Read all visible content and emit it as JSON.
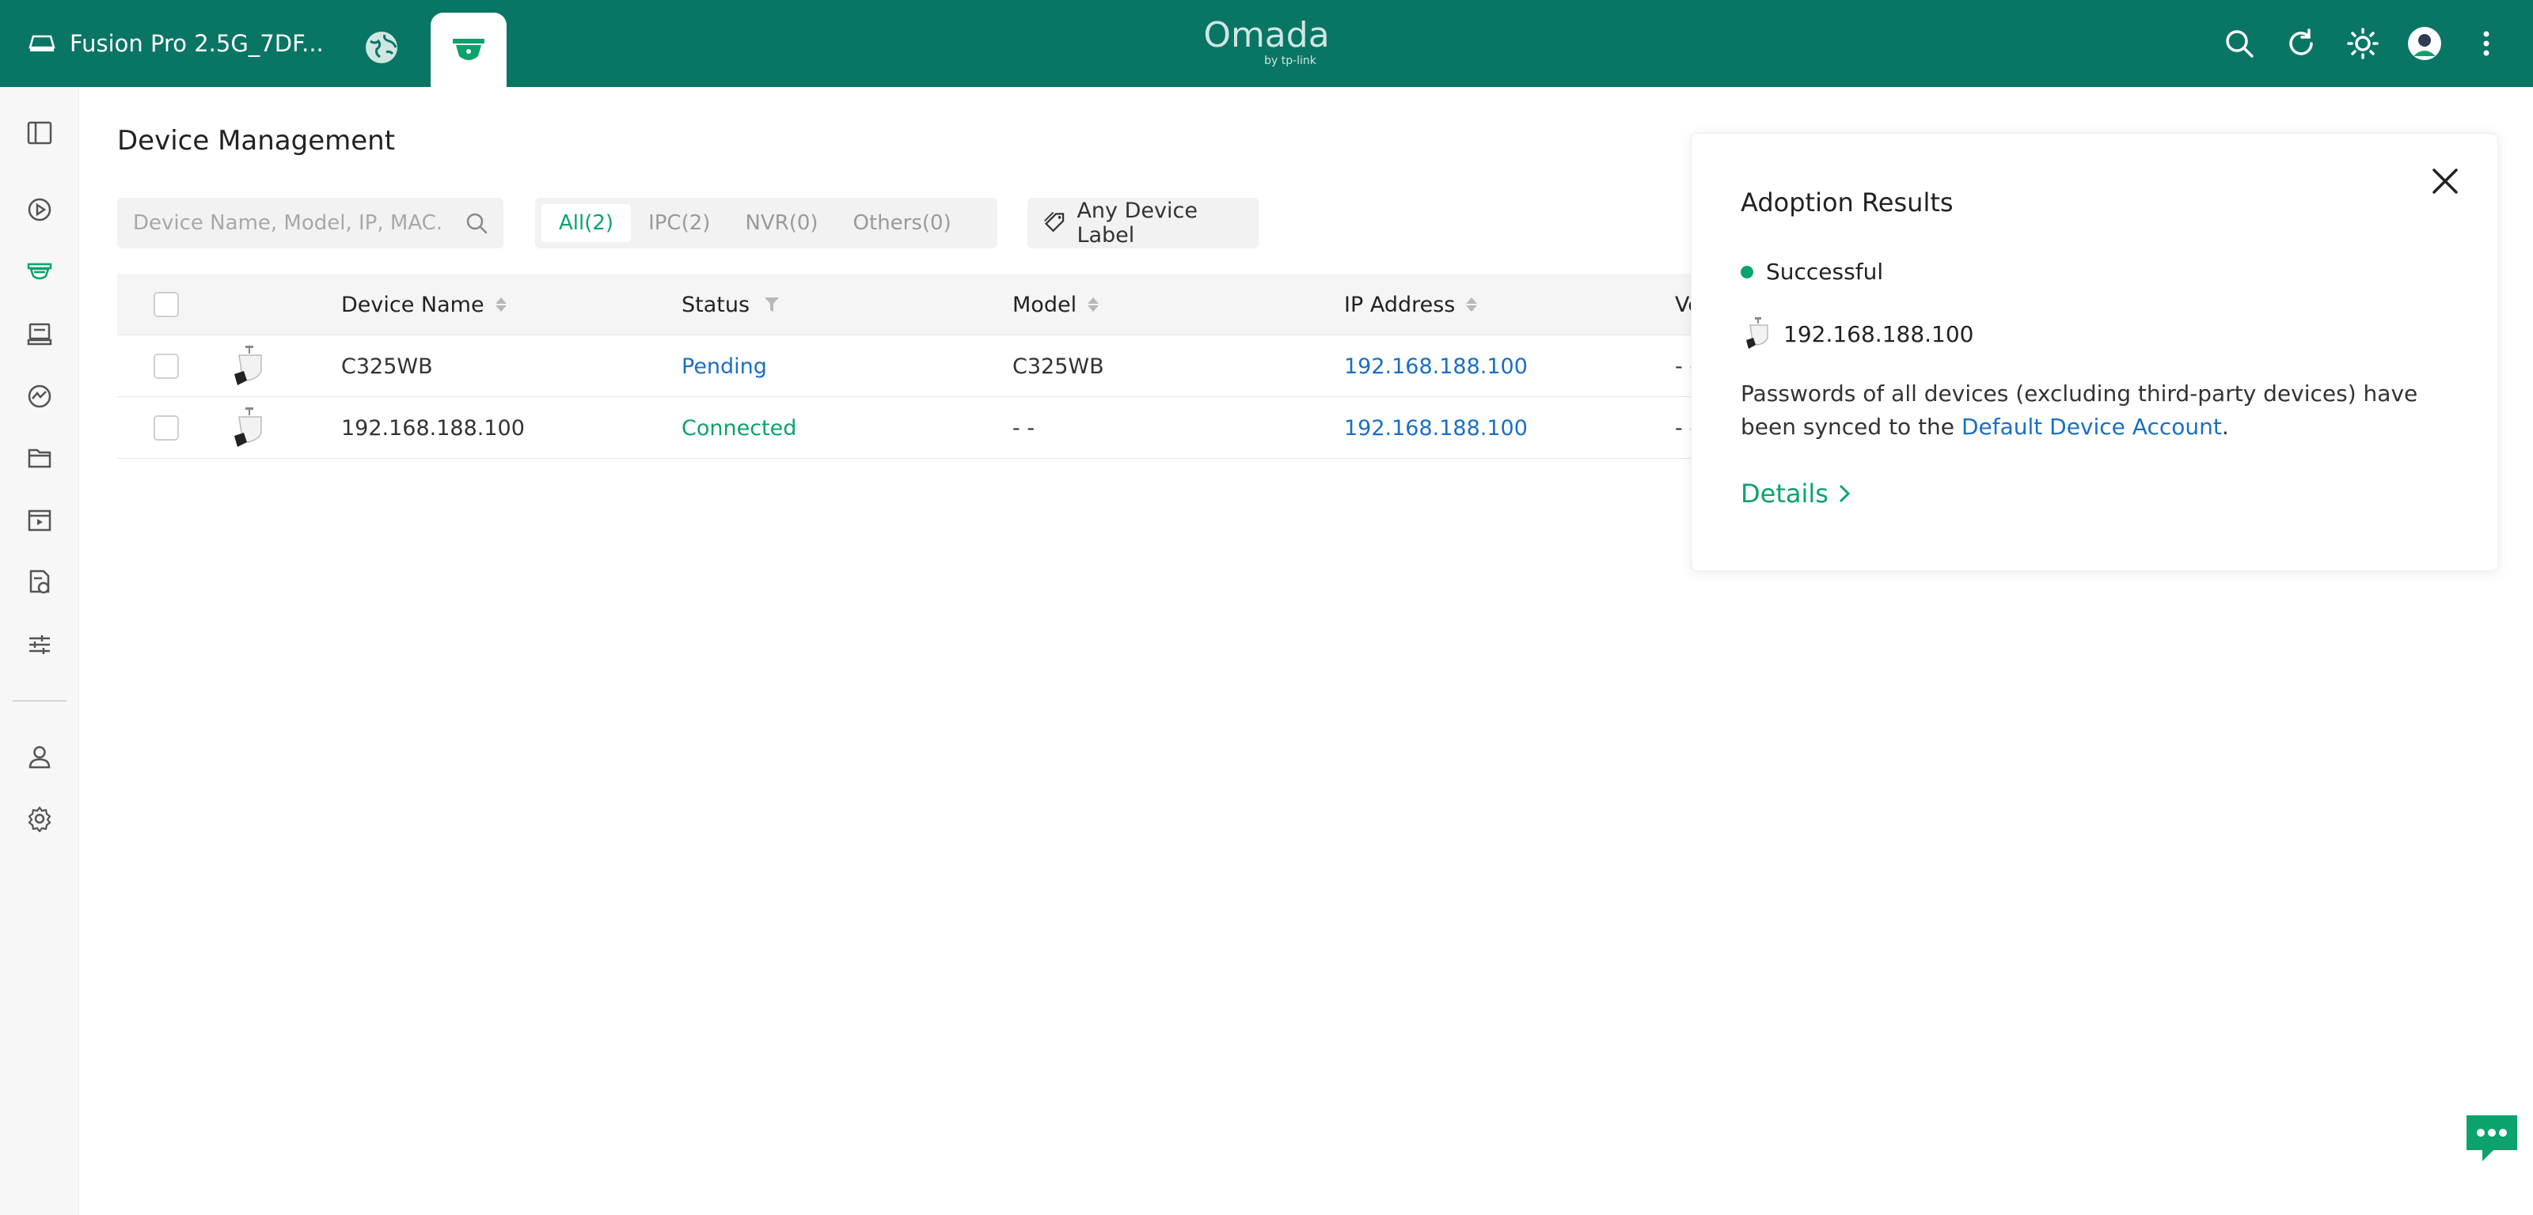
{
  "topbar": {
    "site_name": "Fusion Pro 2.5G_7DF...",
    "logo_text": "Omada",
    "logo_sub": "by tp-link",
    "bg_color": "#087565",
    "icons": [
      "site-icon",
      "globe-icon",
      "surveillance-icon",
      "search-icon",
      "refresh-icon",
      "theme-icon",
      "avatar-icon",
      "more-icon"
    ]
  },
  "sidebar": {
    "items": [
      "sidebar-toggle-icon",
      "live-view-icon",
      "devices-icon",
      "nvr-icon",
      "insights-icon",
      "files-icon",
      "playback-icon",
      "logs-icon",
      "settings-sliders-icon",
      "user-icon",
      "gear-icon"
    ]
  },
  "page": {
    "title": "Device Management"
  },
  "search": {
    "placeholder": "Device Name, Model, IP, MAC."
  },
  "filters": [
    {
      "label": "All(2)",
      "active": true
    },
    {
      "label": "IPC(2)",
      "active": false
    },
    {
      "label": "NVR(0)",
      "active": false
    },
    {
      "label": "Others(0)",
      "active": false
    }
  ],
  "label_filter": "Any Device Label",
  "table": {
    "headers": {
      "device_name": "Device Name",
      "status": "Status",
      "model": "Model",
      "ip": "IP Address",
      "version": "Ve"
    },
    "rows": [
      {
        "name": "C325WB",
        "status": "Pending",
        "model": "C325WB",
        "ip": "192.168.188.100",
        "version": "- -"
      },
      {
        "name": "192.168.188.100",
        "status": "Connected",
        "model": "- -",
        "ip": "192.168.188.100",
        "version": "- -"
      }
    ]
  },
  "panel": {
    "title": "Adoption Results",
    "status": "Successful",
    "device_ip": "192.168.188.100",
    "message_pre": "Passwords of all devices (excluding third-party devices) have been synced to the ",
    "message_link": "Default Device Account",
    "message_post": ".",
    "details": "Details"
  },
  "colors": {
    "accent_green": "#0ba36b",
    "link_blue": "#1a6fc4"
  }
}
